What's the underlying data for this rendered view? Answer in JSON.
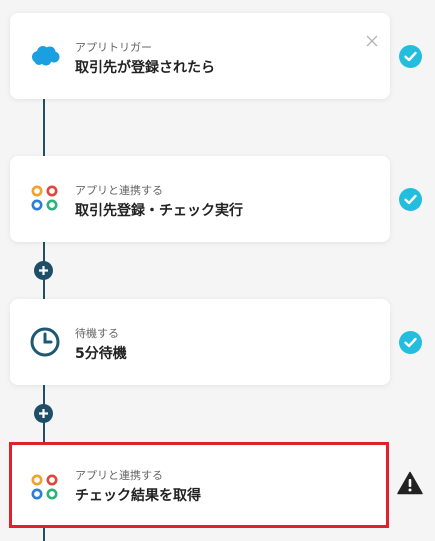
{
  "steps": [
    {
      "subtitle": "アプリトリガー",
      "title": "取引先が登録されたら",
      "icon": "salesforce-cloud-icon",
      "status": "completed"
    },
    {
      "subtitle": "アプリと連携する",
      "title": "取引先登録・チェック実行",
      "icon": "app-rings-icon",
      "status": "completed"
    },
    {
      "subtitle": "待機する",
      "title": "5分待機",
      "icon": "clock-icon",
      "status": "completed"
    },
    {
      "subtitle": "アプリと連携する",
      "title": "チェック結果を取得",
      "icon": "app-rings-icon",
      "status": "warning"
    }
  ],
  "colors": {
    "connector": "#1e4f66",
    "check": "#23bedd",
    "highlight": "#e0202a",
    "salesforce": "#1a9fe0"
  }
}
